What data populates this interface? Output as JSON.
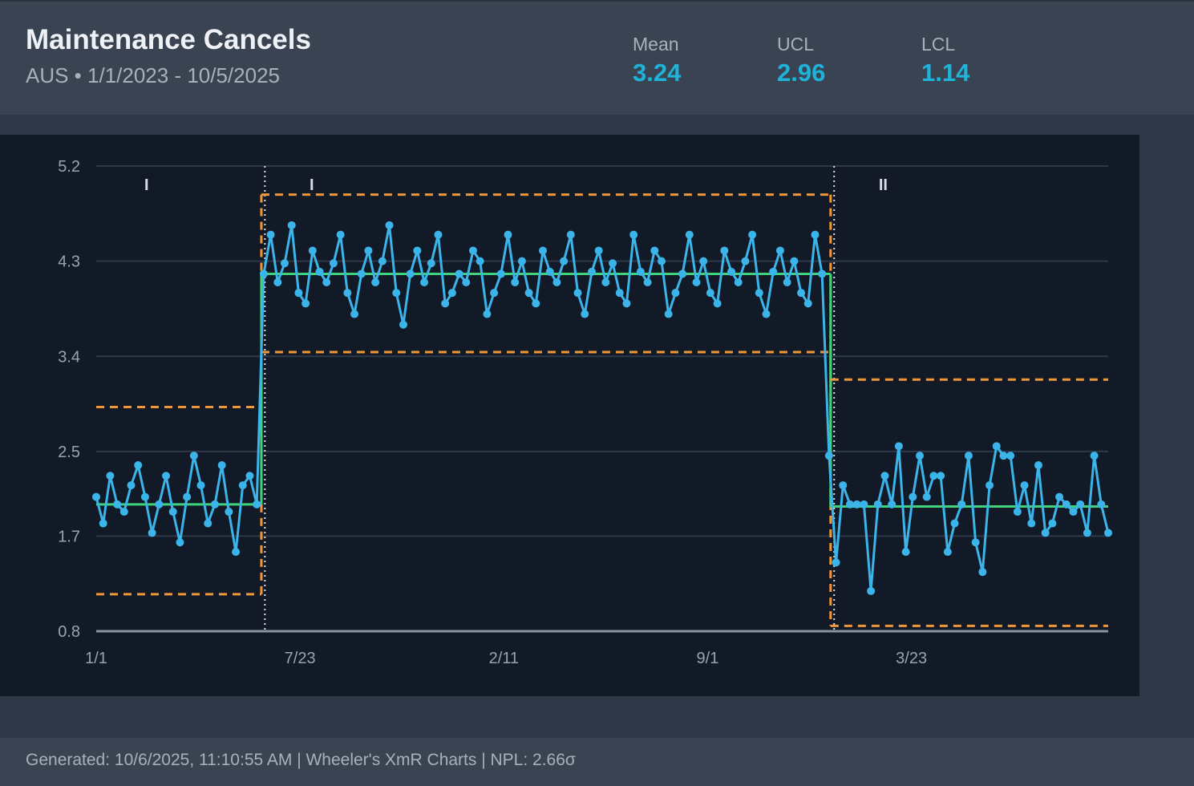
{
  "header": {
    "title": "Maintenance Cancels",
    "subtitle": "AUS • 1/1/2023 - 10/5/2025",
    "stats": [
      {
        "label": "Mean",
        "value": "3.24"
      },
      {
        "label": "UCL",
        "value": "2.96"
      },
      {
        "label": "LCL",
        "value": "1.14"
      }
    ]
  },
  "footer": {
    "text": "Generated: 10/6/2025, 11:10:55 AM | Wheeler's XmR Charts | NPL: 2.66σ"
  },
  "colors": {
    "series": "#3bb4ea",
    "mean": "#3fd27a",
    "limits": "#f0973a",
    "grid": "#2e3848",
    "accent": "#1fb3d9"
  },
  "chart_data": {
    "type": "line",
    "ylim": [
      0.8,
      5.2
    ],
    "yticks": [
      "5.2",
      "4.3",
      "3.4",
      "2.5",
      "1.7",
      "0.8"
    ],
    "ytick_values": [
      5.2,
      4.3,
      3.4,
      2.5,
      1.7,
      0.8
    ],
    "xlim": [
      0,
      144
    ],
    "xticks": [
      {
        "label": "1/1",
        "x": 0
      },
      {
        "label": "7/23",
        "x": 29
      },
      {
        "label": "2/11",
        "x": 58
      },
      {
        "label": "9/1",
        "x": 87
      },
      {
        "label": "3/23",
        "x": 116
      }
    ],
    "phases": [
      {
        "label": "I",
        "start": 0,
        "end": 23.5,
        "mean": 2.0,
        "ucl": 2.92,
        "lcl": 1.15
      },
      {
        "label": "I",
        "start": 23.5,
        "end": 104.5,
        "mean": 4.18,
        "ucl": 4.93,
        "lcl": 3.44
      },
      {
        "label": "II",
        "start": 104.5,
        "end": 144,
        "mean": 1.98,
        "ucl": 3.18,
        "lcl": 0.85
      }
    ],
    "phase_dividers": [
      24,
      105
    ],
    "values": [
      2.07,
      1.82,
      2.27,
      2.0,
      1.93,
      2.18,
      2.37,
      2.07,
      1.73,
      2.0,
      2.27,
      1.93,
      1.64,
      2.07,
      2.46,
      2.18,
      1.82,
      2.0,
      2.37,
      1.93,
      1.55,
      2.18,
      2.27,
      2.0,
      4.18,
      4.55,
      4.1,
      4.28,
      4.64,
      4.0,
      3.9,
      4.4,
      4.2,
      4.1,
      4.28,
      4.55,
      4.0,
      3.8,
      4.18,
      4.4,
      4.1,
      4.3,
      4.64,
      4.0,
      3.7,
      4.18,
      4.4,
      4.1,
      4.28,
      4.55,
      3.9,
      4.0,
      4.18,
      4.1,
      4.4,
      4.3,
      3.8,
      4.0,
      4.18,
      4.55,
      4.1,
      4.3,
      4.0,
      3.9,
      4.4,
      4.2,
      4.1,
      4.3,
      4.55,
      4.0,
      3.8,
      4.2,
      4.4,
      4.1,
      4.28,
      4.0,
      3.9,
      4.55,
      4.2,
      4.1,
      4.4,
      4.3,
      3.8,
      4.0,
      4.18,
      4.55,
      4.1,
      4.3,
      4.0,
      3.9,
      4.4,
      4.2,
      4.1,
      4.3,
      4.55,
      4.0,
      3.8,
      4.2,
      4.4,
      4.1,
      4.3,
      4.0,
      3.9,
      4.55,
      4.18,
      2.46,
      1.45,
      2.18,
      2.0,
      2.0,
      2.0,
      1.18,
      2.0,
      2.27,
      2.0,
      2.55,
      1.55,
      2.07,
      2.46,
      2.07,
      2.27,
      2.27,
      1.55,
      1.82,
      2.0,
      2.46,
      1.64,
      1.36,
      2.18,
      2.55,
      2.46,
      2.46,
      1.93,
      2.18,
      1.82,
      2.37,
      1.73,
      1.82,
      2.07,
      2.0,
      1.93,
      2.0,
      1.73,
      2.46,
      2.0,
      1.73
    ]
  }
}
